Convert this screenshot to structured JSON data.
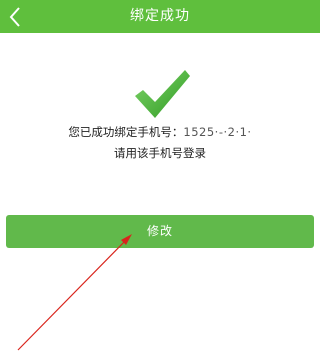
{
  "header": {
    "title": "绑定成功",
    "back_icon": "chevron-left-icon"
  },
  "main": {
    "success_icon": "check-icon",
    "message_line1": "您已成功绑定手机号：",
    "phone_masked": "1525·-·2·1·",
    "message_line2": "请用该手机号登录",
    "modify_label": "修改"
  },
  "colors": {
    "header_bg": "#5fbf3d",
    "button_bg": "#61b94b",
    "check_green": "#3fa62b",
    "arrow_red": "#d9241c"
  }
}
